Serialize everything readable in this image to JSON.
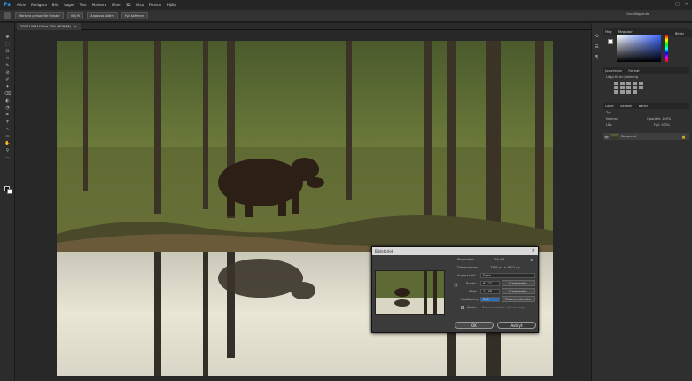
{
  "app": {
    "logo": "Ps",
    "menu": [
      "Arkiv",
      "Redigera",
      "Bild",
      "Lager",
      "Text",
      "Markera",
      "Filter",
      "3D",
      "Visa",
      "Fönster",
      "Hjälp"
    ]
  },
  "window_controls": {
    "minimize": "–",
    "maximize": "□",
    "close": "✕"
  },
  "options_bar": {
    "btn1": "Markera person för fönster",
    "btn2": "Välj fil",
    "btn3": "Anpassa skärm",
    "btn4": "Fyll skärmen",
    "workspace": "Grundläggande"
  },
  "document": {
    "tab": "20G21481443 vid 25% (RGB/8*)",
    "tab_close": "×"
  },
  "tools": [
    "✥",
    "⬚",
    "ⵔ",
    "⌑",
    "✎",
    "⊘",
    "✐",
    "✦",
    "⌫",
    "◐",
    "◔",
    "✒",
    "T",
    "↖",
    "▭",
    "✋",
    "⚲",
    "⋯"
  ],
  "right_dock": {
    "color_tabs": [
      "Färg",
      "Färgrutor"
    ],
    "adjust_tabs": [
      "Justeringar",
      "Format"
    ],
    "adjust_hint": "Lägg till en justering",
    "layer_tabs": [
      "Lager",
      "Kanaler",
      "Banor"
    ],
    "layer_filter": "Typ",
    "layer_mode": "Normal",
    "layer_opacity": "Opacitet: 100%",
    "layer_lock": "Lås:",
    "layer_fill": "Fyll: 100%",
    "layer_name": "Bakgrund",
    "collapsed_label": "Bilder"
  },
  "dialog": {
    "title": "Bildstorlek",
    "close": "✕",
    "size_label": "Bildstorlek:",
    "size_value": "136,4M",
    "dim_label": "Dimensioner:",
    "dim_value": "7360 px × 4912 px",
    "fit_label": "Anpassa till:",
    "fit_value": "Egen",
    "width_label": "Bredd:",
    "width_value": "62,27",
    "width_unit": "Centimeter",
    "height_label": "Höjd:",
    "height_value": "41,58",
    "height_unit": "Centimeter",
    "res_label": "Upplösning:",
    "res_value": "300",
    "res_unit": "Pixlar/centimeter",
    "resample_label": "Ändra",
    "resample_value": "Bevara detaljer (förstoring)",
    "ok": "OK",
    "cancel": "Avbryt"
  },
  "colors": {
    "accent": "#31a8ff",
    "chrome": "#323232",
    "dock": "#2f2f2f"
  }
}
